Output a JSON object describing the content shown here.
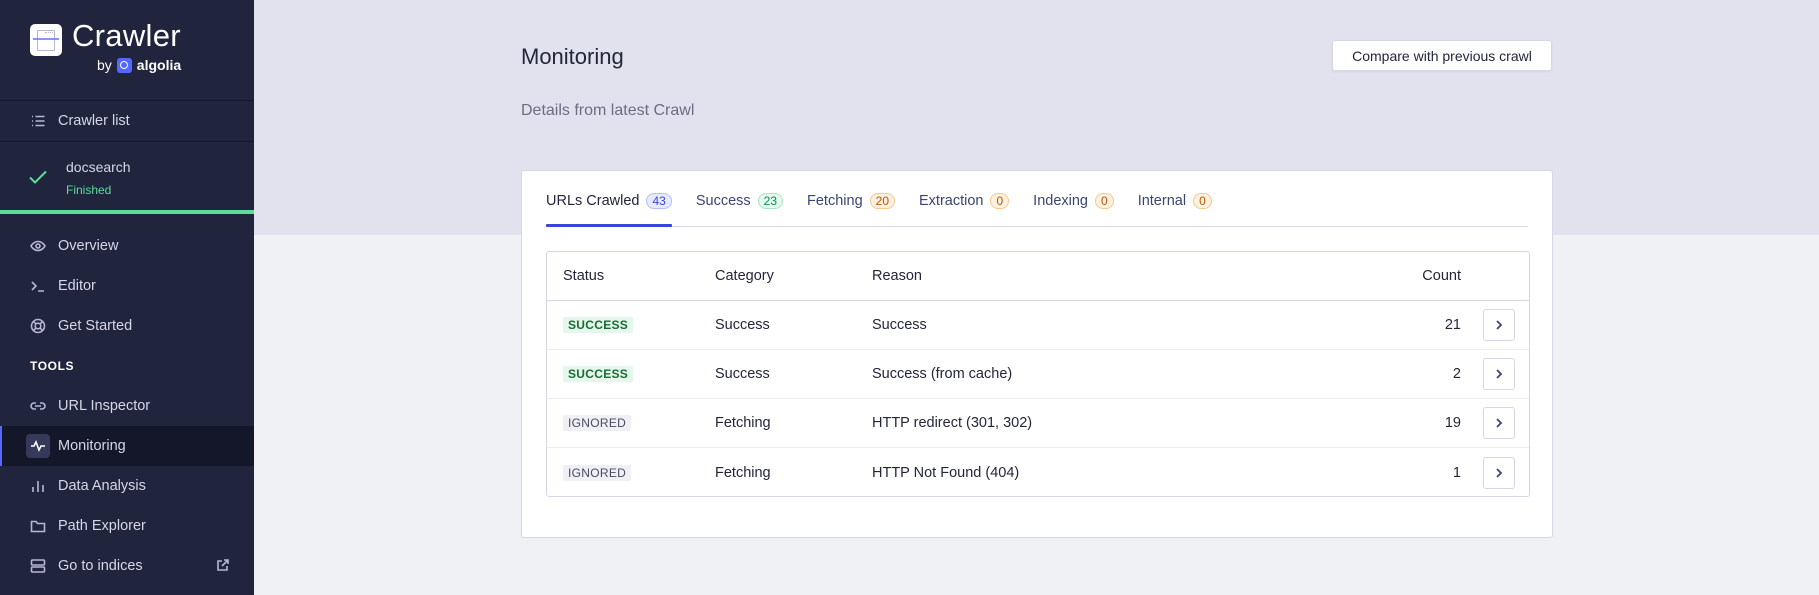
{
  "sidebar": {
    "brand": {
      "name": "Crawler",
      "by": "by",
      "company": "algolia"
    },
    "crawler_list_label": "Crawler list",
    "current_crawler": {
      "name": "docsearch",
      "status": "Finished",
      "progress_percent": 100
    },
    "nav_items": [
      {
        "label": "Overview",
        "icon": "eye-icon"
      },
      {
        "label": "Editor",
        "icon": "terminal-icon"
      },
      {
        "label": "Get Started",
        "icon": "lifebuoy-icon"
      }
    ],
    "tools_title": "TOOLS",
    "tools": [
      {
        "label": "URL Inspector",
        "icon": "link-icon"
      },
      {
        "label": "Monitoring",
        "icon": "activity-icon",
        "active": true
      },
      {
        "label": "Data Analysis",
        "icon": "bar-chart-icon"
      },
      {
        "label": "Path Explorer",
        "icon": "folder-icon"
      },
      {
        "label": "Go to indices",
        "icon": "server-icon",
        "external": true
      }
    ]
  },
  "header": {
    "title": "Monitoring",
    "subtitle": "Details from latest Crawl",
    "compare_button": "Compare with previous crawl"
  },
  "tabs": [
    {
      "label": "URLs Crawled",
      "count": "43",
      "color": "blue",
      "active": true
    },
    {
      "label": "Success",
      "count": "23",
      "color": "green"
    },
    {
      "label": "Fetching",
      "count": "20",
      "color": "orange"
    },
    {
      "label": "Extraction",
      "count": "0",
      "color": "orange"
    },
    {
      "label": "Indexing",
      "count": "0",
      "color": "orange"
    },
    {
      "label": "Internal",
      "count": "0",
      "color": "orange"
    }
  ],
  "table": {
    "columns": {
      "status": "Status",
      "category": "Category",
      "reason": "Reason",
      "count": "Count"
    },
    "rows": [
      {
        "status": "SUCCESS",
        "status_type": "success",
        "category": "Success",
        "reason": "Success",
        "count": "21"
      },
      {
        "status": "SUCCESS",
        "status_type": "success",
        "category": "Success",
        "reason": "Success (from cache)",
        "count": "2"
      },
      {
        "status": "IGNORED",
        "status_type": "ignored",
        "category": "Fetching",
        "reason": "HTTP redirect (301, 302)",
        "count": "19"
      },
      {
        "status": "IGNORED",
        "status_type": "ignored",
        "category": "Fetching",
        "reason": "HTTP Not Found (404)",
        "count": "1"
      }
    ]
  },
  "colors": {
    "sidebar_bg": "#21243d",
    "accent": "#3a46d6",
    "success": "#5adc9a",
    "hero_bg": "#e2e2ef"
  }
}
